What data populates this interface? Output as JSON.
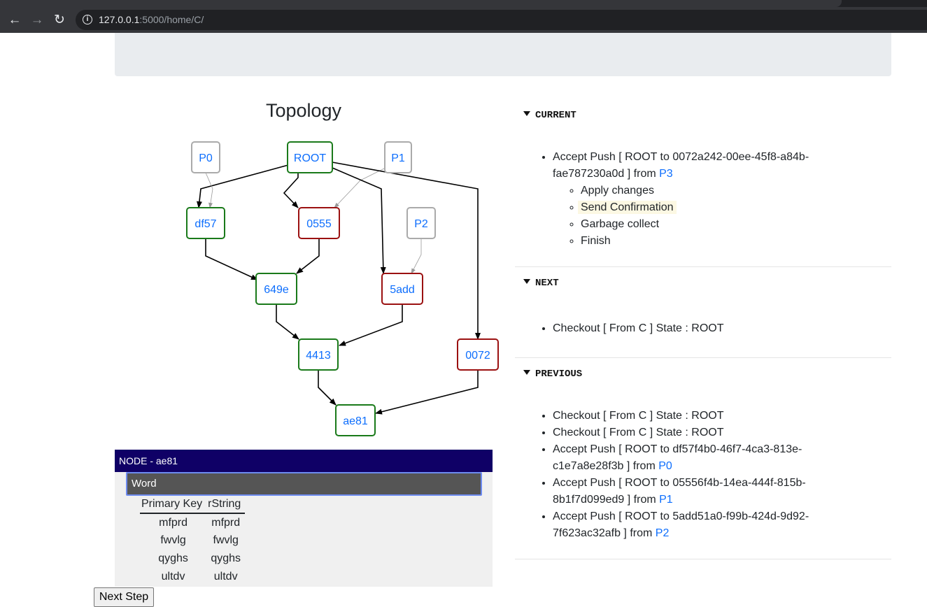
{
  "browser": {
    "url_host": "127.0.0.1",
    "url_path": ":5000/home/C/"
  },
  "topology": {
    "title": "Topology",
    "nodes": [
      {
        "label": "P0",
        "color": "#aaaaaa"
      },
      {
        "label": "ROOT",
        "color": "#1a7a1a"
      },
      {
        "label": "P1",
        "color": "#aaaaaa"
      },
      {
        "label": "df57",
        "color": "#1a7a1a"
      },
      {
        "label": "0555",
        "color": "#9b1111"
      },
      {
        "label": "P2",
        "color": "#aaaaaa"
      },
      {
        "label": "649e",
        "color": "#1a7a1a"
      },
      {
        "label": "5add",
        "color": "#9b1111"
      },
      {
        "label": "4413",
        "color": "#1a7a1a"
      },
      {
        "label": "0072",
        "color": "#9b1111"
      },
      {
        "label": "ae81",
        "color": "#1a7a1a"
      }
    ],
    "edges": [
      {
        "from": "ROOT",
        "to": "df57",
        "style": "bold"
      },
      {
        "from": "P0",
        "to": "df57",
        "style": "thin"
      },
      {
        "from": "ROOT",
        "to": "0555",
        "style": "bold"
      },
      {
        "from": "P1",
        "to": "0555",
        "style": "thin"
      },
      {
        "from": "ROOT",
        "to": "5add",
        "style": "bold"
      },
      {
        "from": "P2",
        "to": "5add",
        "style": "thin"
      },
      {
        "from": "ROOT",
        "to": "0072",
        "style": "bold"
      },
      {
        "from": "df57",
        "to": "649e",
        "style": "bold"
      },
      {
        "from": "0555",
        "to": "649e",
        "style": "bold"
      },
      {
        "from": "649e",
        "to": "4413",
        "style": "bold"
      },
      {
        "from": "5add",
        "to": "4413",
        "style": "bold"
      },
      {
        "from": "4413",
        "to": "ae81",
        "style": "bold"
      },
      {
        "from": "0072",
        "to": "ae81",
        "style": "bold"
      }
    ]
  },
  "node_panel": {
    "header": "NODE - ae81",
    "word": "Word",
    "columns": [
      "Primary Key",
      "rString"
    ],
    "rows": [
      [
        "mfprd",
        "mfprd"
      ],
      [
        "fwvlg",
        "fwvlg"
      ],
      [
        "qyghs",
        "qyghs"
      ],
      [
        "ultdv",
        "ultdv"
      ]
    ]
  },
  "next_button": "Next Step",
  "current": {
    "title": "CURRENT",
    "item_text": "Accept Push [ ROOT to 0072a242-00ee-45f8-a84b-fae787230a0d ] from ",
    "item_link": "P3",
    "steps": [
      "Apply changes",
      "Send Confirmation",
      "Garbage collect",
      "Finish"
    ],
    "highlighted_step": "Send Confirmation"
  },
  "next": {
    "title": "NEXT",
    "items": [
      "Checkout [ From C ] State : ROOT"
    ]
  },
  "previous": {
    "title": "PREVIOUS",
    "items": [
      {
        "text": "Checkout [ From C ] State : ROOT",
        "link": ""
      },
      {
        "text": "Checkout [ From C ] State : ROOT",
        "link": ""
      },
      {
        "text": "Accept Push [ ROOT to df57f4b0-46f7-4ca3-813e-c1e7a8e28f3b ] from ",
        "link": "P0"
      },
      {
        "text": "Accept Push [ ROOT to 05556f4b-14ea-444f-815b-8b1f7d099ed9 ] from ",
        "link": "P1"
      },
      {
        "text": "Accept Push [ ROOT to 5add51a0-f99b-424d-9d92-7f623ac32afb ] from ",
        "link": "P2"
      }
    ]
  }
}
